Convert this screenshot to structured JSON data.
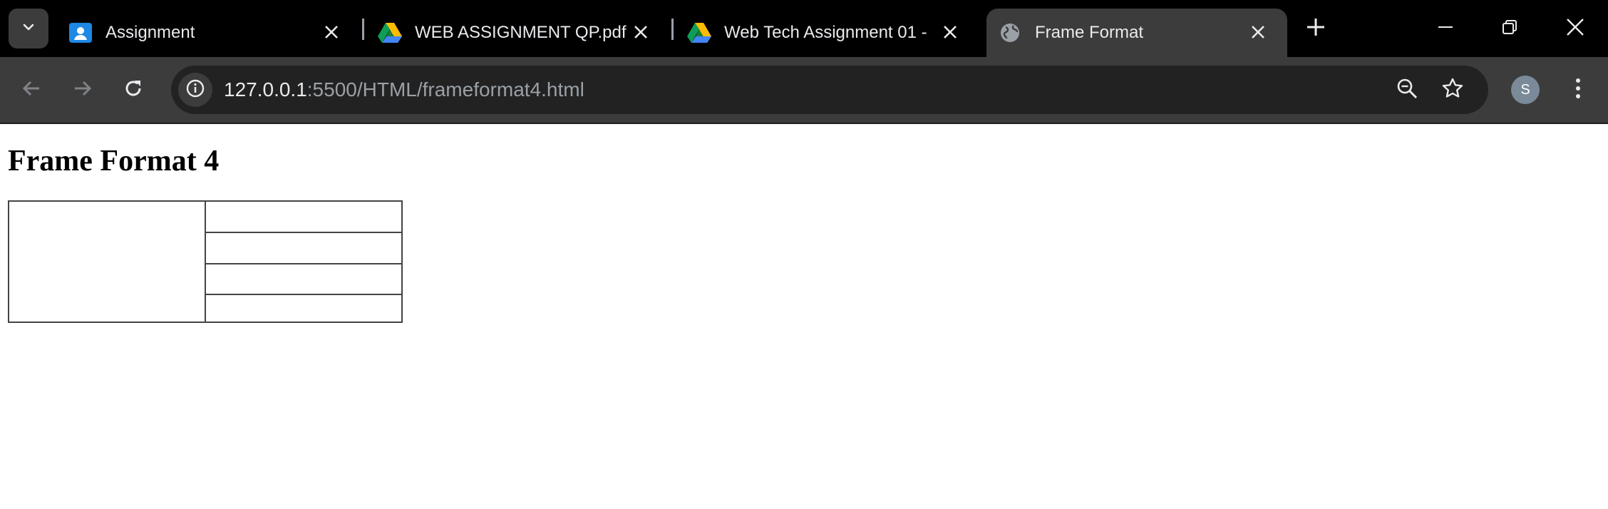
{
  "browser": {
    "tabs": [
      {
        "title": "Assignment",
        "icon": "classroom-icon",
        "active": false
      },
      {
        "title": "WEB ASSIGNMENT QP.pdf - ",
        "icon": "google-drive-icon",
        "active": false
      },
      {
        "title": "Web Tech Assignment 01 - ",
        "icon": "google-drive-icon",
        "active": false
      },
      {
        "title": "Frame Format",
        "icon": "globe-icon",
        "active": true
      }
    ],
    "address": {
      "host": "127.0.0.1",
      "path": ":5500/HTML/frameformat4.html"
    },
    "profile_initial": "S",
    "colors": {
      "tabstrip": "#000000",
      "toolbar": "#3c3c3c",
      "omnibox": "#222222",
      "text": "#e8eaed"
    }
  },
  "page": {
    "heading": "Frame Format 4",
    "frames": {
      "left_count": 1,
      "right_rows": 4
    }
  }
}
